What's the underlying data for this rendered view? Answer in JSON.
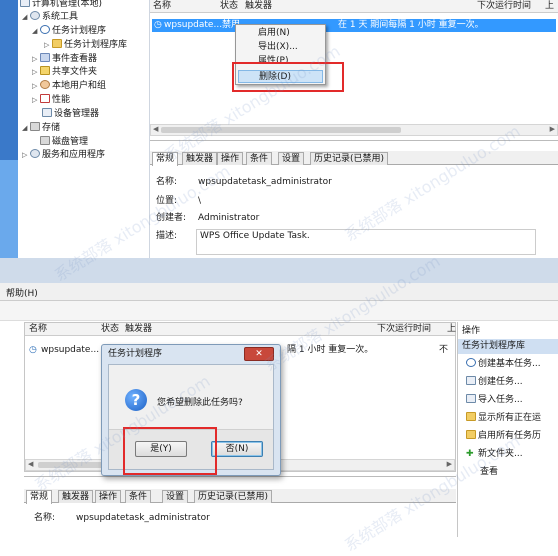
{
  "top_panel": {
    "tree": {
      "root": "计算机管理(本地)",
      "items": [
        "系统工具",
        "任务计划程序",
        "任务计划程序库",
        "事件查看器",
        "共享文件夹",
        "本地用户和组",
        "性能",
        "设备管理器",
        "存储",
        "磁盘管理",
        "服务和应用程序"
      ]
    },
    "list_headers": [
      "名称",
      "状态",
      "触发器",
      "下次运行时间",
      "上"
    ],
    "row": {
      "name": "wpsupdate...",
      "status": "禁用",
      "trigger": "在 1 天 期间每隔 1 小时 重复一次。"
    },
    "context_menu": [
      "启用(N)",
      "导出(X)...",
      "属性(P)",
      "删除(D)"
    ],
    "tabs": [
      "常规",
      "触发器",
      "操作",
      "条件",
      "设置",
      "历史记录(已禁用)"
    ],
    "fields": {
      "name_label": "名称:",
      "name_value": "wpsupdatetask_administrator",
      "location_label": "位置:",
      "location_value": "\\",
      "author_label": "创建者:",
      "author_value": "Administrator",
      "desc_label": "描述:",
      "desc_value": "WPS Office Update Task."
    }
  },
  "bottom_panel": {
    "menu_help": "帮助(H)",
    "list_headers": [
      "名称",
      "状态",
      "触发器",
      "下次运行时间",
      "上"
    ],
    "row": {
      "name": "wpsupdate...",
      "trigger": "隔 1 小时 重复一次。",
      "last": "不"
    },
    "dialog": {
      "title": "任务计划程序",
      "message": "您希望删除此任务吗?",
      "yes": "是(Y)",
      "no": "否(N)"
    },
    "tabs": [
      "常规",
      "触发器",
      "操作",
      "条件",
      "设置",
      "历史记录(已禁用)"
    ],
    "fields": {
      "name_label": "名称:",
      "name_value": "wpsupdatetask_administrator"
    },
    "actions": {
      "title": "操作",
      "section": "任务计划程序库",
      "items": [
        "创建基本任务...",
        "创建任务...",
        "导入任务...",
        "显示所有正在运",
        "启用所有任务历",
        "新文件夹...",
        "查看"
      ]
    }
  },
  "watermark": "系统部落 xitongbuluo.com"
}
